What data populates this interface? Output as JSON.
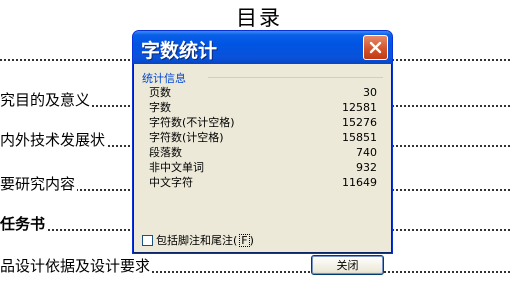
{
  "document": {
    "title": "目录",
    "toc": [
      {
        "text": "",
        "bold": false
      },
      {
        "text": "究目的及意义",
        "bold": false
      },
      {
        "text": "内外技术发展状",
        "bold": false
      },
      {
        "text": "要研究内容",
        "bold": false
      },
      {
        "text": "任务书",
        "bold": true
      },
      {
        "text": "品设计依据及设计要求",
        "bold": false
      }
    ]
  },
  "dialog": {
    "title": "字数统计",
    "group_label": "统计信息",
    "stats": [
      {
        "label": "页数",
        "value": "30"
      },
      {
        "label": "字数",
        "value": "12581"
      },
      {
        "label": "字符数(不计空格)",
        "value": "15276"
      },
      {
        "label": "字符数(计空格)",
        "value": "15851"
      },
      {
        "label": "段落数",
        "value": "740"
      },
      {
        "label": "非中文单词",
        "value": "932"
      },
      {
        "label": "中文字符",
        "value": "11649"
      }
    ],
    "checkbox": {
      "label": "包括脚注和尾注",
      "key": "F",
      "checked": false
    },
    "close_button": "关闭",
    "close_icon": "close-x-icon"
  }
}
